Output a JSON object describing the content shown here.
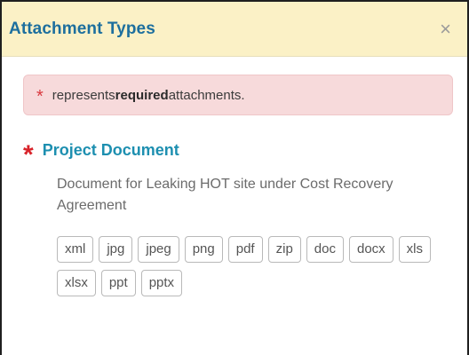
{
  "dialog": {
    "title": "Attachment Types",
    "close_glyph": "×"
  },
  "alert": {
    "star": "*",
    "prefix": "represents ",
    "emphasis": "required",
    "suffix": " attachments."
  },
  "attachment": {
    "required_marker": "*",
    "name": "Project Document",
    "description": "Document for Leaking HOT site under Cost Recovery Agreement",
    "file_types": [
      "xml",
      "jpg",
      "jpeg",
      "png",
      "pdf",
      "zip",
      "doc",
      "docx",
      "xls",
      "xlsx",
      "ppt",
      "pptx"
    ]
  },
  "colors": {
    "header_bg": "#fbf1c6",
    "title": "#1d6f9e",
    "alert_bg": "#f7dadb",
    "required": "#d8232a",
    "link": "#1d8fb0"
  },
  "icons": {
    "close": "close-icon",
    "required": "required-asterisk-icon"
  }
}
